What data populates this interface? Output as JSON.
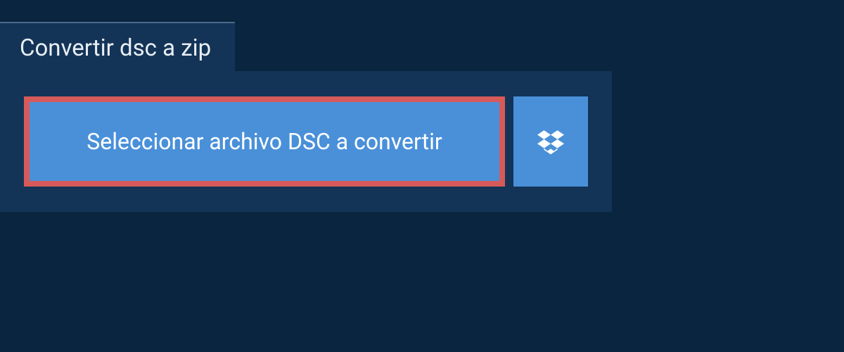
{
  "tab": {
    "title": "Convertir dsc a zip"
  },
  "actions": {
    "select_file_label": "Seleccionar archivo DSC a convertir"
  },
  "colors": {
    "background": "#0a2540",
    "panel": "#133457",
    "button": "#4a90d9",
    "highlight_border": "#d65a5a"
  }
}
